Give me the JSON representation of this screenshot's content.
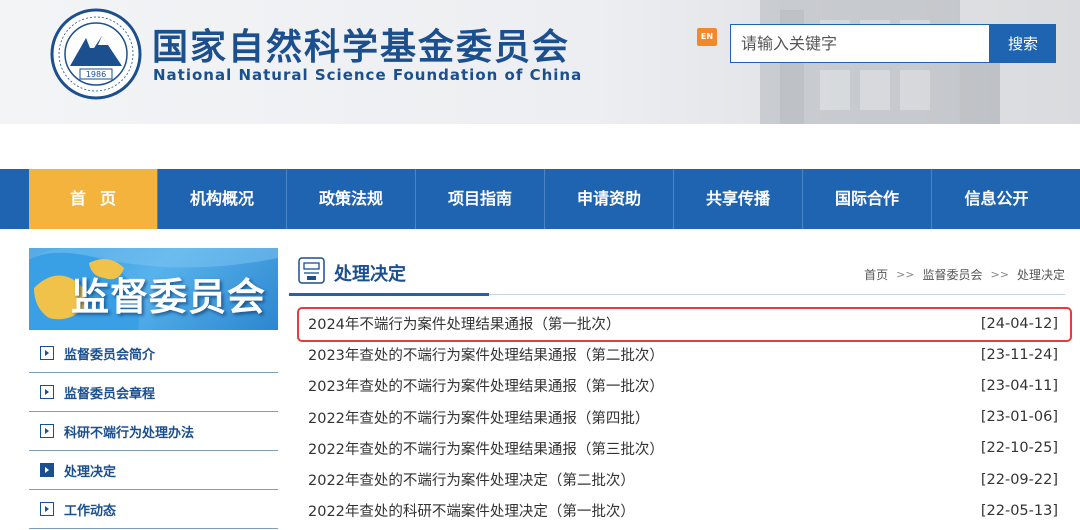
{
  "header": {
    "title_cn": "国家自然科学基金委员会",
    "title_en": "National Natural Science Foundation of China",
    "logo_year": "1986",
    "en_label": "EN",
    "search_placeholder": "请输入关键字",
    "search_button": "搜索"
  },
  "nav": {
    "items": [
      "首页",
      "机构概况",
      "政策法规",
      "项目指南",
      "申请资助",
      "共享传播",
      "国际合作",
      "信息公开"
    ],
    "active_index": 0
  },
  "sidebar": {
    "banner_text": "监督委员会",
    "items": [
      {
        "label": "监督委员会简介",
        "active": false
      },
      {
        "label": "监督委员会章程",
        "active": false
      },
      {
        "label": "科研不端行为处理办法",
        "active": false
      },
      {
        "label": "处理决定",
        "active": true
      },
      {
        "label": "工作动态",
        "active": false
      }
    ]
  },
  "main": {
    "section_title": "处理决定",
    "breadcrumb": [
      "首页",
      "监督委员会",
      "处理决定"
    ],
    "breadcrumb_separator": ">>",
    "news": [
      {
        "title": "2024年不端行为案件处理结果通报（第一批次）",
        "date": "[24-04-12]",
        "highlighted": true
      },
      {
        "title": "2023年查处的不端行为案件处理结果通报（第二批次）",
        "date": "[23-11-24]"
      },
      {
        "title": "2023年查处的不端行为案件处理结果通报（第一批次）",
        "date": "[23-04-11]"
      },
      {
        "title": "2022年查处的不端行为案件处理结果通报（第四批）",
        "date": "[23-01-06]"
      },
      {
        "title": "2022年查处的不端行为案件处理结果通报（第三批次）",
        "date": "[22-10-25]"
      },
      {
        "title": "2022年查处的不端行为案件处理决定（第二批次）",
        "date": "[22-09-22]"
      },
      {
        "title": "2022年查处的科研不端案件处理决定（第一批次）",
        "date": "[22-05-13]"
      }
    ]
  },
  "colors": {
    "brand_blue": "#1f64b0",
    "title_blue": "#1b4f8e",
    "nav_active": "#f3b33d",
    "en_orange": "#f0892b",
    "highlight_red": "#e53c3c"
  }
}
